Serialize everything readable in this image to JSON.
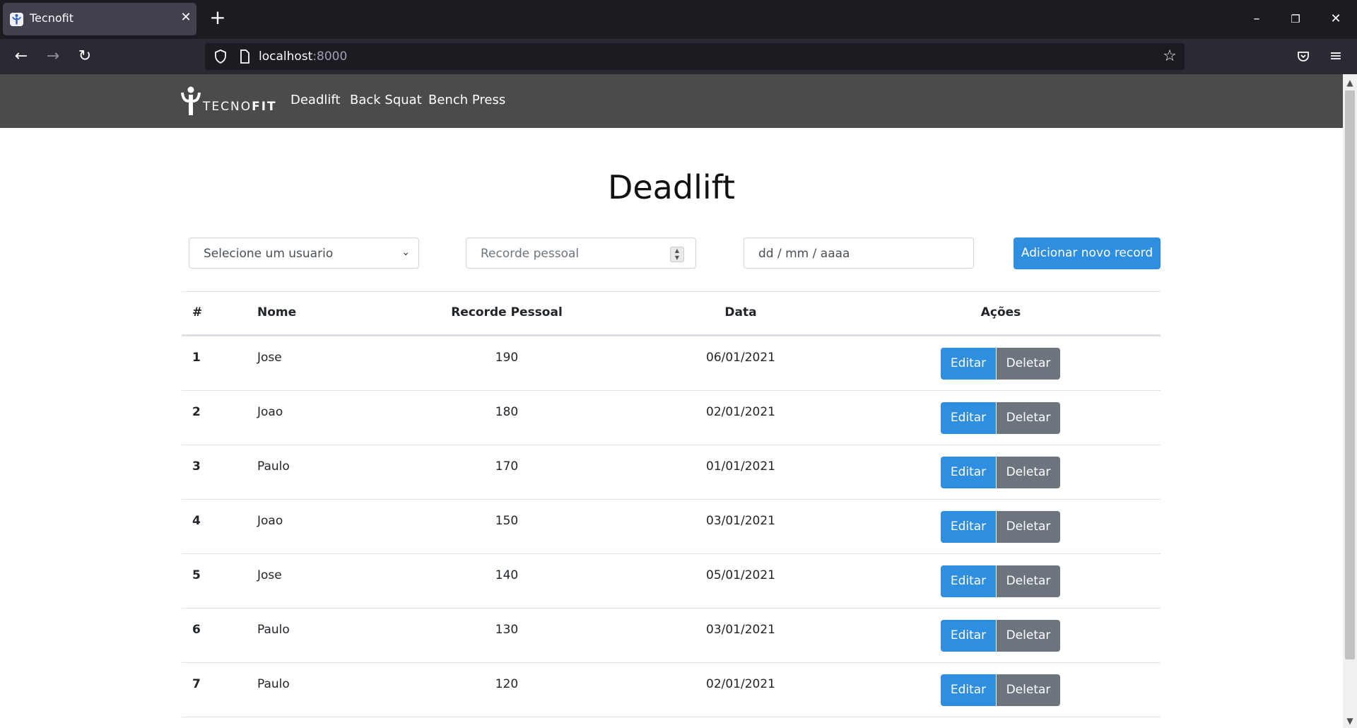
{
  "browser": {
    "tab_title": "Tecnofit",
    "url_host": "localhost",
    "url_port": ":8000"
  },
  "site": {
    "brand_light": "TECNO",
    "brand_bold": "FIT",
    "nav": [
      "Deadlift",
      "Back Squat",
      "Bench Press"
    ]
  },
  "page": {
    "title": "Deadlift",
    "form": {
      "user_select": "Selecione um usuario",
      "record_placeholder": "Recorde pessoal",
      "date_placeholder": "dd / mm / aaaa",
      "add_button": "Adicionar novo record"
    },
    "table": {
      "headers": [
        "#",
        "Nome",
        "Recorde Pessoal",
        "Data",
        "Ações"
      ],
      "rows": [
        {
          "idx": "1",
          "nome": "Jose",
          "recorde": "190",
          "data": "06/01/2021"
        },
        {
          "idx": "2",
          "nome": "Joao",
          "recorde": "180",
          "data": "02/01/2021"
        },
        {
          "idx": "3",
          "nome": "Paulo",
          "recorde": "170",
          "data": "01/01/2021"
        },
        {
          "idx": "4",
          "nome": "Joao",
          "recorde": "150",
          "data": "03/01/2021"
        },
        {
          "idx": "5",
          "nome": "Jose",
          "recorde": "140",
          "data": "05/01/2021"
        },
        {
          "idx": "6",
          "nome": "Paulo",
          "recorde": "130",
          "data": "03/01/2021"
        },
        {
          "idx": "7",
          "nome": "Paulo",
          "recorde": "120",
          "data": "02/01/2021"
        }
      ],
      "edit_label": "Editar",
      "delete_label": "Deletar"
    }
  },
  "colors": {
    "primary": "#2e8ee0",
    "secondary": "#6c757d",
    "site_nav": "#4b4b4b"
  }
}
